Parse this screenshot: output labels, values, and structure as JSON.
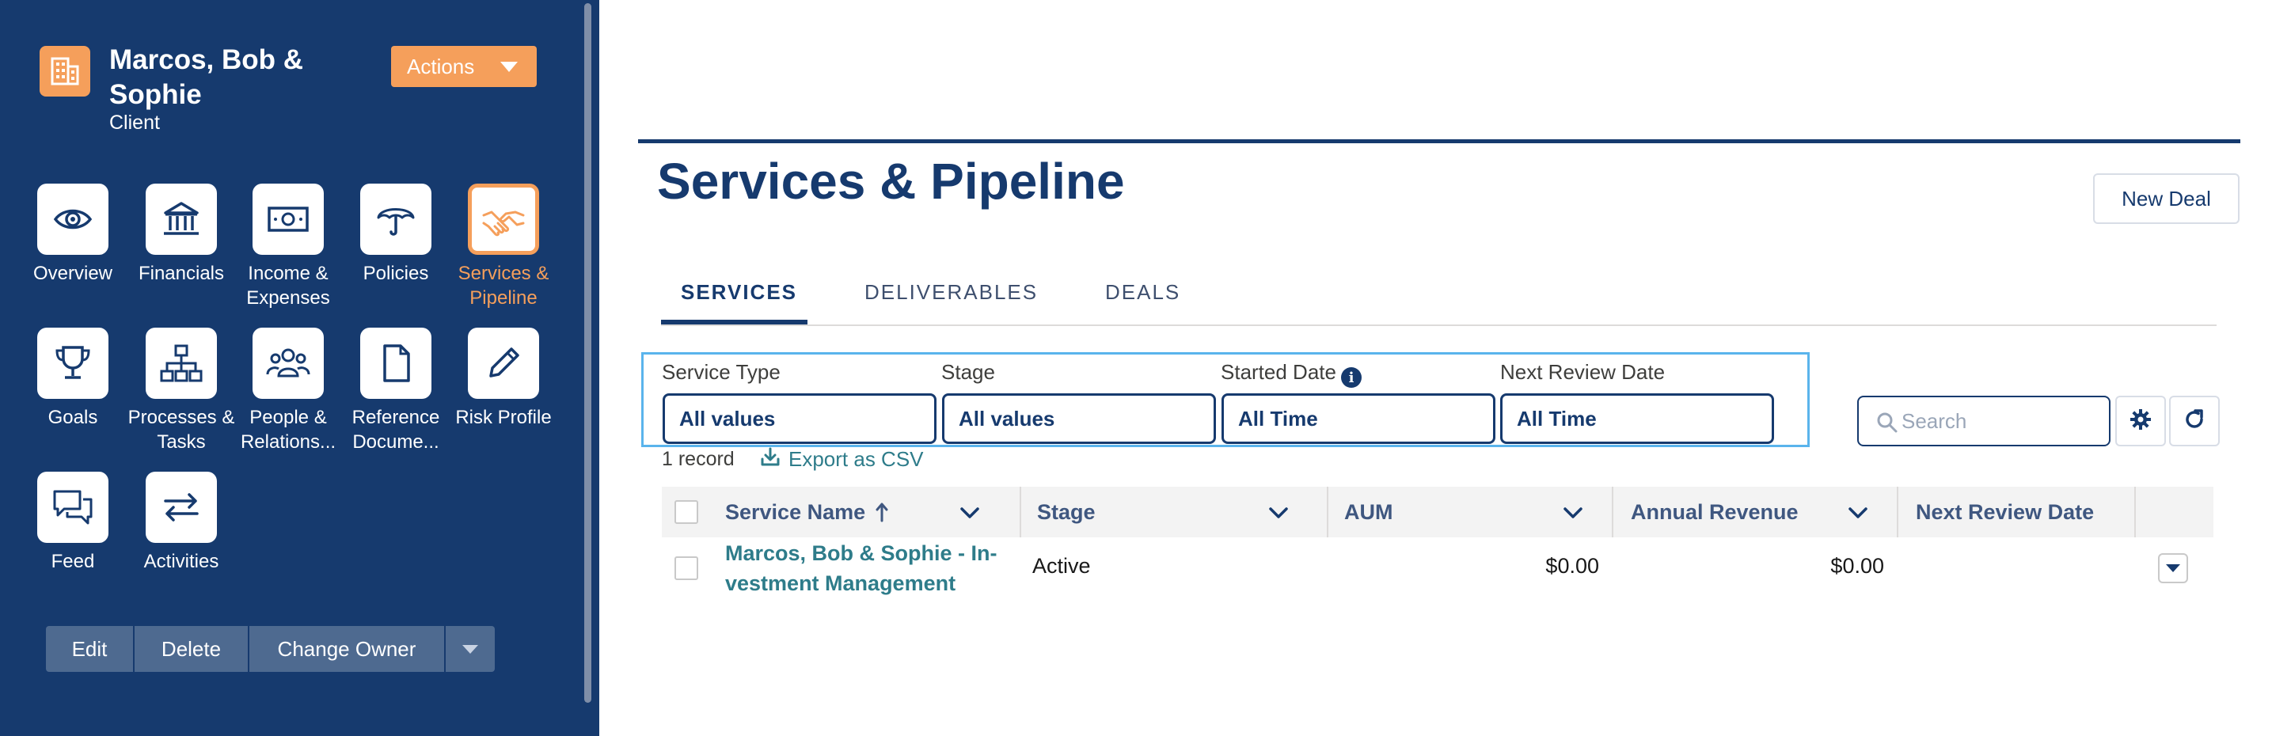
{
  "sidebar": {
    "account_name": "Marcos, Bob & Sophie",
    "account_type": "Client",
    "actions_label": "Actions",
    "nav": [
      {
        "label": "Overview",
        "icon": "eye-icon"
      },
      {
        "label": "Financials",
        "icon": "bank-icon"
      },
      {
        "label": "Income & Expenses",
        "icon": "money-icon"
      },
      {
        "label": "Policies",
        "icon": "umbrella-icon"
      },
      {
        "label": "Services & Pipeline",
        "icon": "handshake-icon",
        "active": true
      },
      {
        "label": "Goals",
        "icon": "trophy-icon"
      },
      {
        "label": "Processes & Tasks",
        "icon": "hierarchy-icon"
      },
      {
        "label": "People & Relations...",
        "icon": "people-icon"
      },
      {
        "label": "Reference Docume...",
        "icon": "document-icon"
      },
      {
        "label": "Risk Profile",
        "icon": "pencil-icon"
      },
      {
        "label": "Feed",
        "icon": "chat-icon"
      },
      {
        "label": "Activities",
        "icon": "swap-icon"
      }
    ],
    "buttons": {
      "edit": "Edit",
      "delete": "Delete",
      "change_owner": "Change Owner"
    }
  },
  "main": {
    "title": "Services & Pipeline",
    "new_deal_label": "New Deal",
    "tabs": [
      {
        "label": "SERVICES",
        "active": true
      },
      {
        "label": "DELIVERABLES"
      },
      {
        "label": "DEALS"
      }
    ],
    "filters": [
      {
        "label": "Service Type",
        "value": "All values"
      },
      {
        "label": "Stage",
        "value": "All values"
      },
      {
        "label": "Started Date",
        "value": "All Time"
      },
      {
        "label": "Next Review Date",
        "value": "All Time"
      }
    ],
    "search_placeholder": "Search",
    "record_count": "1 record",
    "export_label": "Export as CSV",
    "table": {
      "columns": [
        "Service Name",
        "Stage",
        "AUM",
        "Annual Revenue",
        "Next Review Date"
      ],
      "rows": [
        {
          "service_name_line1": "Marcos, Bob & Sophie - In-",
          "service_name_line2": "vestment Management",
          "stage": "Active",
          "aum": "$0.00",
          "annual_revenue": "$0.00",
          "next_review_date": ""
        }
      ]
    }
  },
  "colors": {
    "sidebar_bg": "#163a6e",
    "accent_orange": "#f59f5b",
    "link_teal": "#2e7c8a",
    "focus_blue": "#5ab4ec"
  }
}
